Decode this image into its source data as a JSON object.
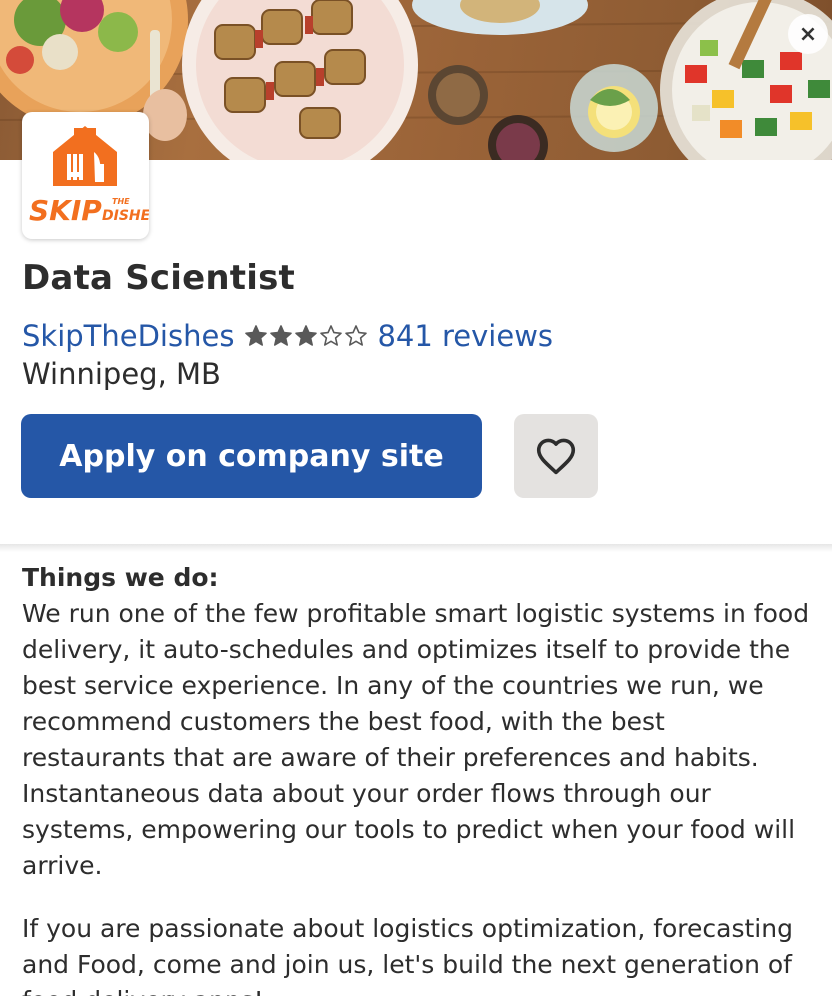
{
  "header": {
    "close_label": "×",
    "logo_text": "SKIP",
    "logo_subtext": "THE",
    "logo_subtext2": "DISHES"
  },
  "job": {
    "title": "Data Scientist",
    "company": "SkipTheDishes",
    "rating": 3,
    "rating_max": 5,
    "reviews": "841 reviews",
    "location": "Winnipeg, MB"
  },
  "actions": {
    "apply_label": "Apply on company site",
    "save_icon": "heart-icon"
  },
  "description": {
    "heading": "Things we do:",
    "paragraphs": [
      "We run one of the few profitable smart logistic systems in food delivery, it auto-schedules and optimizes itself to provide the best service experience. In any of the countries we run, we recommend customers the best food, with the best restaurants that are aware of their preferences and habits. Instantaneous data about your order flows through our systems, empowering our tools to predict when your food will arrive.",
      "If you are passionate about logistics optimization, forecasting and Food, come and join us, let's build the next generation of food delivery apps!"
    ]
  },
  "colors": {
    "link": "#2557a7",
    "apply_button": "#2557a7",
    "save_button": "#e4e2e0",
    "brand_orange": "#f26f1f",
    "star": "#595959"
  }
}
